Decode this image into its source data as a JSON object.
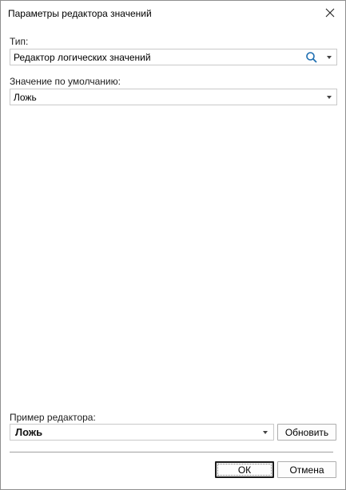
{
  "dialog": {
    "title": "Параметры редактора значений"
  },
  "type_field": {
    "label": "Тип:",
    "value": "Редактор логических значений"
  },
  "default_field": {
    "label": "Значение по умолчанию:",
    "value": "Ложь"
  },
  "sample": {
    "label": "Пример редактора:",
    "value": "Ложь",
    "refresh_label": "Обновить"
  },
  "footer": {
    "ok_label": "ОК",
    "cancel_label": "Отмена"
  },
  "colors": {
    "search_icon": "#1f6fb2",
    "border": "#c9c9c9"
  },
  "icons": {
    "close": "close-icon",
    "search": "search-icon",
    "dropdown": "chevron-down-icon"
  }
}
